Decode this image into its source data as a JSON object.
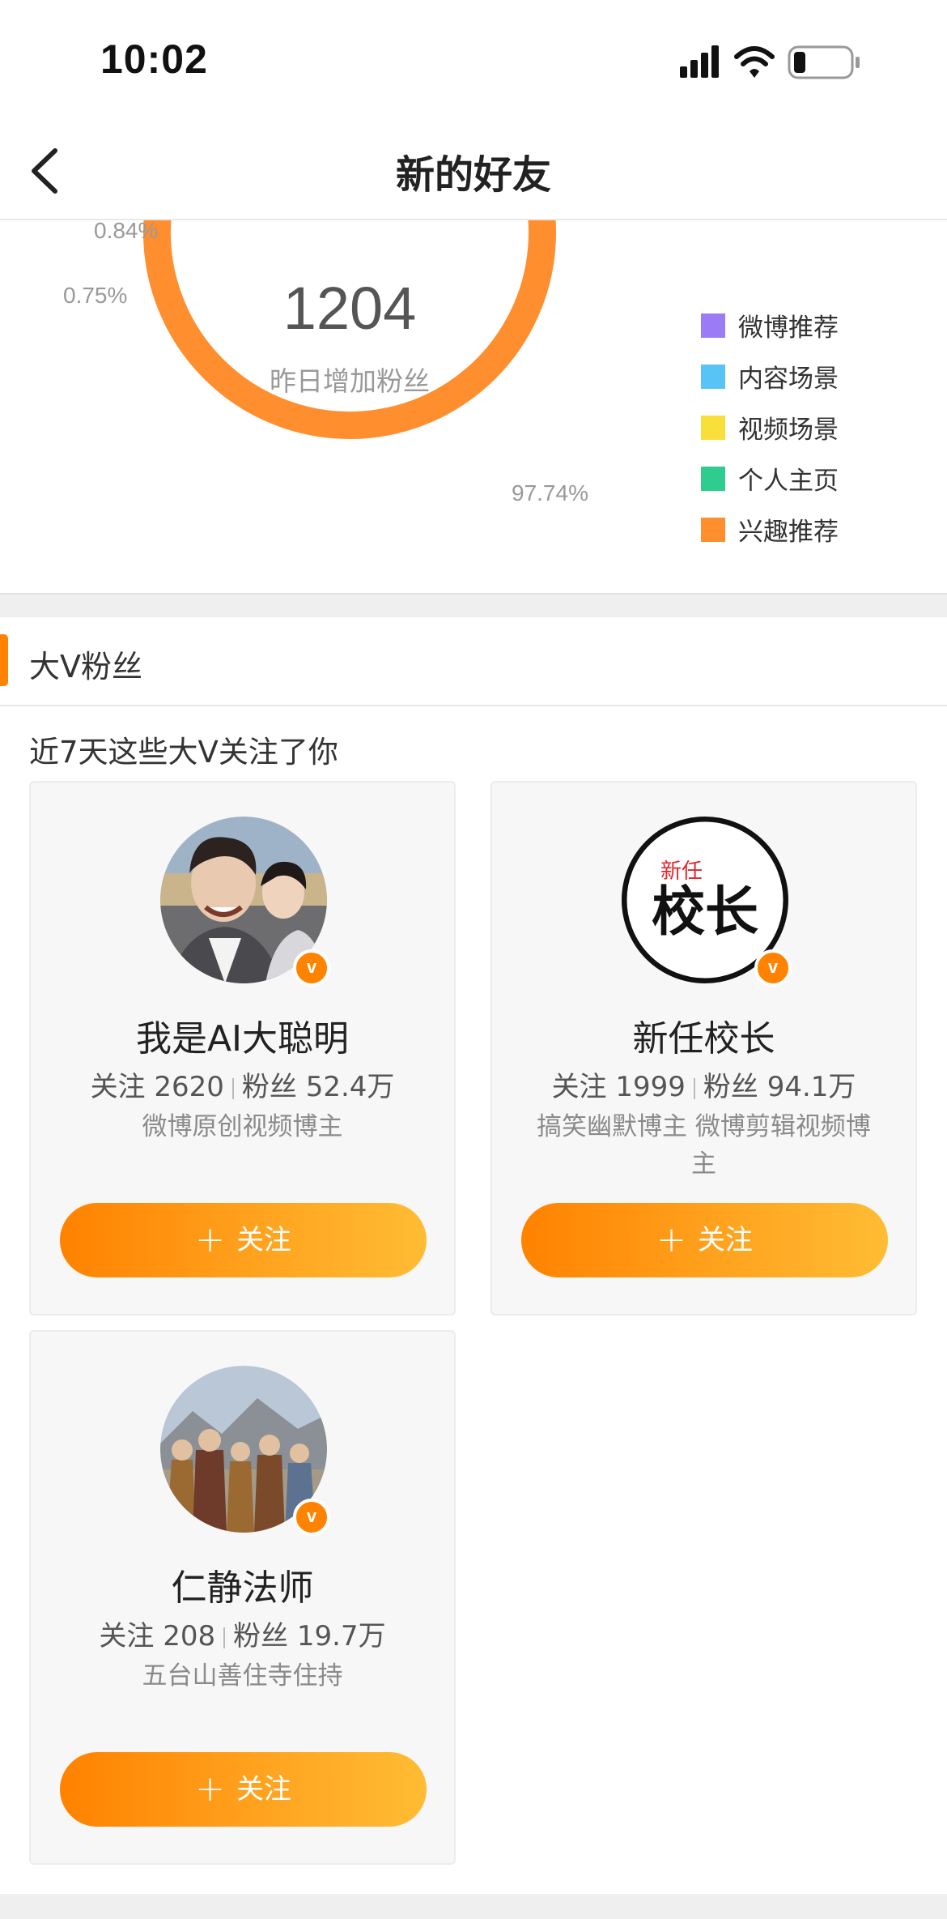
{
  "status_bar": {
    "time": "10:02"
  },
  "nav": {
    "title": "新的好友"
  },
  "donut": {
    "center_value": "1204",
    "center_label": "昨日增加粉丝",
    "labels": {
      "weibo": "0.75%",
      "content": "0.84%",
      "interest": "97.74%"
    }
  },
  "chart_data": {
    "type": "pie",
    "center_value": "1204",
    "center_label": "昨日增加粉丝",
    "series": [
      {
        "name": "微博推荐",
        "value": 0.75,
        "color": "#9b7cf5"
      },
      {
        "name": "内容场景",
        "value": 0.84,
        "color": "#58c4f6"
      },
      {
        "name": "视频场景",
        "value": 0.33,
        "color": "#f9df3a"
      },
      {
        "name": "个人主页",
        "value": 0.34,
        "color": "#2ecc8f"
      },
      {
        "name": "兴趣推荐",
        "value": 97.74,
        "color": "#ff8f2e"
      }
    ]
  },
  "legend": [
    {
      "label": "微博推荐",
      "color": "#9b7cf5"
    },
    {
      "label": "内容场景",
      "color": "#58c4f6"
    },
    {
      "label": "视频场景",
      "color": "#f9df3a"
    },
    {
      "label": "个人主页",
      "color": "#2ecc8f"
    },
    {
      "label": "兴趣推荐",
      "color": "#ff8f2e"
    }
  ],
  "section": {
    "title": "大V粉丝",
    "subtitle": "近7天这些大V关注了你"
  },
  "cards": [
    {
      "name": "我是AI大聪明",
      "follow_label": "关注",
      "follow_count": "2620",
      "fans_label": "粉丝",
      "fans_count": "52.4万",
      "desc": "微博原创视频博主",
      "button": "关注",
      "badge": "v"
    },
    {
      "name": "新任校长",
      "follow_label": "关注",
      "follow_count": "1999",
      "fans_label": "粉丝",
      "fans_count": "94.1万",
      "desc": "搞笑幽默博主 微博剪辑视频博主",
      "button": "关注",
      "badge": "v",
      "logo_text_small": "新任",
      "logo_text_big": "校长"
    },
    {
      "name": "仁静法师",
      "follow_label": "关注",
      "follow_count": "208",
      "fans_label": "粉丝",
      "fans_count": "19.7万",
      "desc": "五台山善住寺住持",
      "button": "关注",
      "badge": "v"
    }
  ],
  "colors": {
    "accent": "#ff8200"
  }
}
